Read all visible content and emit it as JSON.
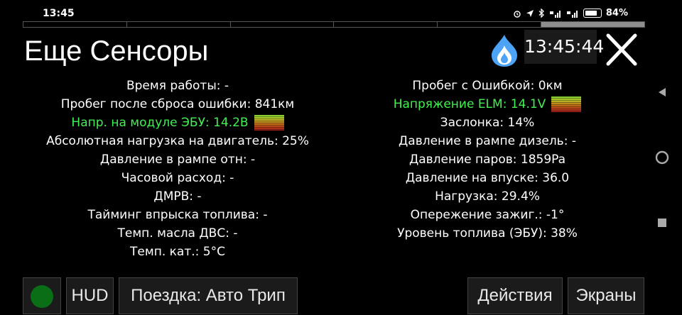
{
  "status_bar": {
    "time": "13:45",
    "battery_percent": "84%",
    "signal_icon_1": "signal-icon",
    "signal_icon_2": "signal-icon"
  },
  "page_indicator": {
    "total": 6,
    "active_index": 5
  },
  "header": {
    "title": "Еще Сенсоры",
    "clock": "13:45:44"
  },
  "colors": {
    "green_text": "#44ee55",
    "status_dot": "#0a6e16",
    "flame_blue": "#4da3f5"
  },
  "sensors_left": [
    {
      "label": "Время работы: -",
      "highlight": false
    },
    {
      "label": "Пробег после сброса ошибки: 841км",
      "highlight": false
    },
    {
      "label": "Напр. на модуле ЭБУ: 14.2В",
      "highlight": true
    },
    {
      "label": "Абсолютная нагрузка на двигатель: 25%",
      "highlight": false
    },
    {
      "label": "Давление в рампе отн: -",
      "highlight": false
    },
    {
      "label": "Часовой расход: -",
      "highlight": false
    },
    {
      "label": "ДМРВ: -",
      "highlight": false
    },
    {
      "label": "Тайминг впрыска топлива: -",
      "highlight": false
    },
    {
      "label": "Темп. масла ДВС: -",
      "highlight": false
    },
    {
      "label": "Темп. кат.: 5°C",
      "highlight": false
    }
  ],
  "sensors_right": [
    {
      "label": "Пробег с Ошибкой: 0км",
      "highlight": false
    },
    {
      "label": "Напряжение ELM: 14.1V",
      "highlight": true
    },
    {
      "label": "Заслонка: 14%",
      "highlight": false
    },
    {
      "label": "Давление в рампе дизель: -",
      "highlight": false
    },
    {
      "label": "Давление паров: 1859Pa",
      "highlight": false
    },
    {
      "label": "Давление на впуске: 36.0",
      "highlight": false
    },
    {
      "label": "Нагрузка: 29.4%",
      "highlight": false
    },
    {
      "label": "Опережение зажиг.: -1°",
      "highlight": false
    },
    {
      "label": "Уровень топлива (ЭБУ): 38%",
      "highlight": false
    }
  ],
  "toolbar": {
    "hud_label": "HUD",
    "trip_label": "Поездка: Авто Трип",
    "actions_label": "Действия",
    "screens_label": "Экраны"
  }
}
